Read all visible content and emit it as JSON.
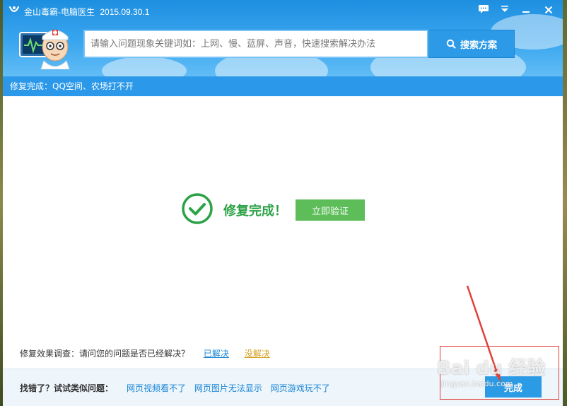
{
  "window": {
    "title": "金山毒霸-电脑医生",
    "version": "2015.09.30.1"
  },
  "search": {
    "placeholder": "请输入问题现象关键词如：上网、慢、蓝屏、声音，快速搜索解决办法",
    "button_label": "搜索方案"
  },
  "status_strip": {
    "text": "修复完成：QQ空间、农场打不开"
  },
  "result": {
    "title": "修复完成！",
    "verify_button": "立即验证"
  },
  "survey": {
    "question": "修复效果调查：请问您的问题是否已经解决？",
    "resolved": "已解决",
    "unresolved": "没解决"
  },
  "footer": {
    "label": "找错了？试试类似问题：",
    "links": [
      "网页视频看不了",
      "网页图片无法显示",
      "网页游戏玩不了"
    ],
    "done_button": "完成"
  },
  "watermark": {
    "brand": "Bai du 经验",
    "url": "jingyan.baidu.com"
  },
  "colors": {
    "header_blue": "#2b98ea",
    "success_green": "#2ba245",
    "verify_green": "#5cbd59",
    "link_blue": "#1a86d6",
    "annotation_red": "#e0403a"
  }
}
